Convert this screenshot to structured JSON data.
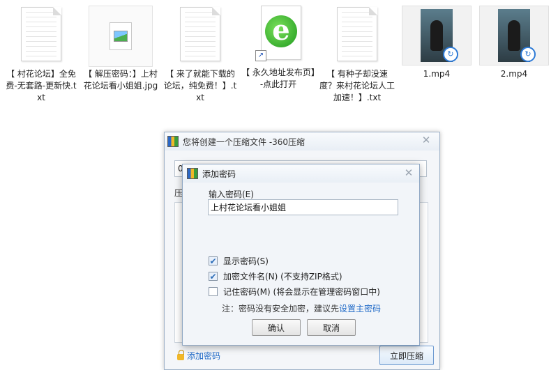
{
  "files": [
    {
      "type": "txt",
      "icon": "text-document-icon",
      "name": "【 村花论坛】全免费-无套路-更新快.txt"
    },
    {
      "type": "jpg",
      "icon": "image-file-icon",
      "name": "【 解压密码：】上村花论坛看小姐姐.jpg"
    },
    {
      "type": "txt",
      "icon": "text-document-icon",
      "name": "【 来了就能下载的论坛，纯免费！】.txt"
    },
    {
      "type": "url",
      "icon": "internet-shortcut-icon",
      "name": "【 永久地址发布页】-点此打开"
    },
    {
      "type": "txt",
      "icon": "text-document-icon",
      "name": "【 有种子却没速度？来村花论坛人工加速！】.txt"
    },
    {
      "type": "video",
      "icon": "video-thumbnail-icon",
      "name": "1.mp4"
    },
    {
      "type": "video",
      "icon": "video-thumbnail-icon",
      "name": "2.mp4"
    }
  ],
  "main_dialog": {
    "title": "您将创建一个压缩文件 -360压缩",
    "field_value": "0",
    "label_partial": "压",
    "add_password_link": "添加密码",
    "compress_button": "立即压缩",
    "close_glyph": "✕"
  },
  "password_dialog": {
    "title": "添加密码",
    "close_glyph": "✕",
    "input_label": "输入密码(E)",
    "password_value": "上村花论坛看小姐姐",
    "options": [
      {
        "label": "显示密码(S)",
        "checked": true
      },
      {
        "label": "加密文件名(N) (不支持ZIP格式)",
        "checked": true
      },
      {
        "label": "记住密码(M) (将会显示在管理密码窗口中)",
        "checked": false
      }
    ],
    "note_text": "注：密码没有安全加密，建议先",
    "note_link": "设置主密码",
    "ok_button": "确认",
    "cancel_button": "取消"
  },
  "colors": {
    "link": "#1f69c7",
    "dialog_border": "#8fa7c3",
    "checkbox_check": "#2f6fb9"
  }
}
